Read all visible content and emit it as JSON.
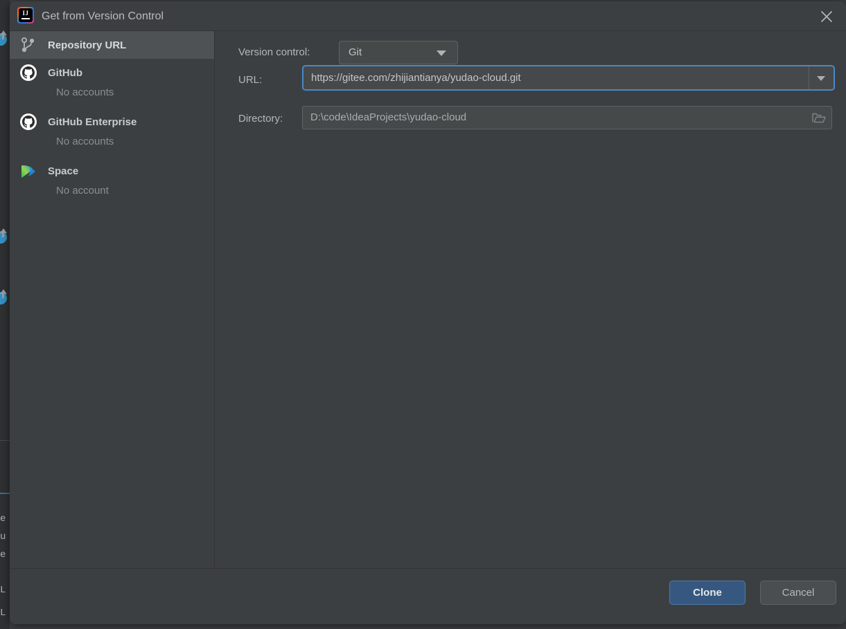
{
  "window": {
    "title": "Get from Version Control",
    "app_icon": "intellij-idea-icon",
    "close_icon": "close-icon"
  },
  "sidebar": {
    "items": [
      {
        "label": "Repository URL",
        "sub": "",
        "icon": "git-branch-icon",
        "selected": true
      },
      {
        "label": "GitHub",
        "sub": "No accounts",
        "icon": "github-icon",
        "selected": false
      },
      {
        "label": "GitHub Enterprise",
        "sub": "No accounts",
        "icon": "github-icon",
        "selected": false
      },
      {
        "label": "Space",
        "sub": "No account",
        "icon": "jetbrains-space-icon",
        "selected": false
      }
    ]
  },
  "form": {
    "version_control": {
      "label": "Version control:",
      "value": "Git",
      "options": [
        "Git"
      ],
      "caret_icon": "chevron-down-icon"
    },
    "url": {
      "label": "URL:",
      "value": "https://gitee.com/zhijiantianya/yudao-cloud.git",
      "placeholder": "",
      "focused": true,
      "dropdown_icon": "chevron-down-icon"
    },
    "directory": {
      "label": "Directory:",
      "value": "D:\\code\\IdeaProjects\\yudao-cloud",
      "placeholder": "",
      "browse_icon": "folder-icon"
    }
  },
  "footer": {
    "clone_label": "Clone",
    "cancel_label": "Cancel"
  },
  "colors": {
    "dialog_background": "#3c3f41",
    "field_background": "#45494a",
    "selected_row": "#4e5254",
    "focus_ring": "#4a88c7",
    "primary_button": "#365880",
    "text_primary": "#bbbbbb",
    "text_muted": "#8b8f91"
  }
}
